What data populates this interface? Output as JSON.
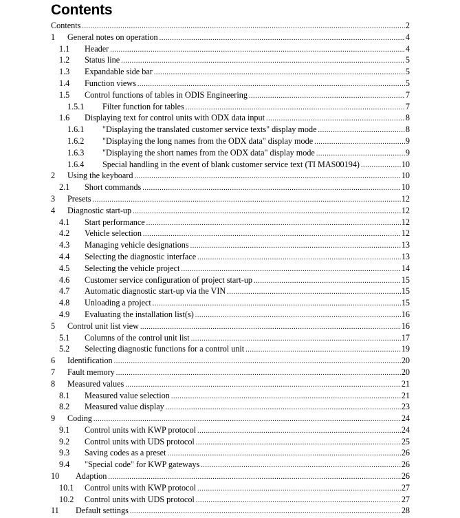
{
  "document": {
    "title": "Contents"
  },
  "toc": [
    {
      "level": 0,
      "number": "",
      "text": "Contents",
      "page": "2"
    },
    {
      "level": 1,
      "number": "1",
      "text": "General notes on operation",
      "page": "4"
    },
    {
      "level": 2,
      "number": "1.1",
      "text": "Header",
      "page": "4"
    },
    {
      "level": 2,
      "number": "1.2",
      "text": "Status line",
      "page": "5"
    },
    {
      "level": 2,
      "number": "1.3",
      "text": "Expandable side bar",
      "page": "5"
    },
    {
      "level": 2,
      "number": "1.4",
      "text": "Function views",
      "page": "5"
    },
    {
      "level": 2,
      "number": "1.5",
      "text": "Control functions of tables in ODIS Engineering",
      "page": "7"
    },
    {
      "level": 3,
      "number": "1.5.1",
      "text": "Filter function for tables",
      "page": "7"
    },
    {
      "level": 2,
      "number": "1.6",
      "text": "Displaying text for control units with ODX data input",
      "page": "8"
    },
    {
      "level": 3,
      "number": "1.6.1",
      "text": "\"Displaying the translated customer service texts\" display mode",
      "page": "8"
    },
    {
      "level": 3,
      "number": "1.6.2",
      "text": "\"Displaying the long names from the ODX data\" display mode",
      "page": "9"
    },
    {
      "level": 3,
      "number": "1.6.3",
      "text": "\"Displaying the short names from the ODX data\" display mode",
      "page": "9"
    },
    {
      "level": 3,
      "number": "1.6.4",
      "text": "Special handling in the event of blank customer service text (TI MAS00194)",
      "page": "10"
    },
    {
      "level": 1,
      "number": "2",
      "text": "Using the keyboard",
      "page": "10"
    },
    {
      "level": 2,
      "number": "2.1",
      "text": "Short commands",
      "page": "10"
    },
    {
      "level": 1,
      "number": "3",
      "text": "Presets",
      "page": "12"
    },
    {
      "level": 1,
      "number": "4",
      "text": "Diagnostic start-up",
      "page": "12"
    },
    {
      "level": 2,
      "number": "4.1",
      "text": "Start performance",
      "page": "12"
    },
    {
      "level": 2,
      "number": "4.2",
      "text": "Vehicle selection",
      "page": "12"
    },
    {
      "level": 2,
      "number": "4.3",
      "text": "Managing vehicle designations",
      "page": "13"
    },
    {
      "level": 2,
      "number": "4.4",
      "text": "Selecting the diagnostic interface",
      "page": "13"
    },
    {
      "level": 2,
      "number": "4.5",
      "text": "Selecting the vehicle project",
      "page": "14"
    },
    {
      "level": 2,
      "number": "4.6",
      "text": "Customer service configuration of project start-up",
      "page": "15"
    },
    {
      "level": 2,
      "number": "4.7",
      "text": "Automatic diagnostic start-up via the VIN",
      "page": "15"
    },
    {
      "level": 2,
      "number": "4.8",
      "text": "Unloading a project",
      "page": "15"
    },
    {
      "level": 2,
      "number": "4.9",
      "text": "Evaluating the installation list(s)",
      "page": "16"
    },
    {
      "level": 1,
      "number": "5",
      "text": "Control unit list view",
      "page": "16"
    },
    {
      "level": 2,
      "number": "5.1",
      "text": "Columns of the control unit list",
      "page": "17"
    },
    {
      "level": 2,
      "number": "5.2",
      "text": "Selecting diagnostic functions for a control unit",
      "page": "19"
    },
    {
      "level": 1,
      "number": "6",
      "text": "Identification",
      "page": "20"
    },
    {
      "level": 1,
      "number": "7",
      "text": "Fault memory",
      "page": "20"
    },
    {
      "level": 1,
      "number": "8",
      "text": "Measured values",
      "page": "21"
    },
    {
      "level": 2,
      "number": "8.1",
      "text": "Measured value selection",
      "page": "21"
    },
    {
      "level": 2,
      "number": "8.2",
      "text": "Measured value display",
      "page": "23"
    },
    {
      "level": 1,
      "number": "9",
      "text": "Coding",
      "page": "24"
    },
    {
      "level": 2,
      "number": "9.1",
      "text": "Control units with KWP protocol",
      "page": "24"
    },
    {
      "level": 2,
      "number": "9.2",
      "text": "Control units with UDS protocol",
      "page": "25"
    },
    {
      "level": 2,
      "number": "9.3",
      "text": "Saving codes as a preset",
      "page": "26"
    },
    {
      "level": 2,
      "number": "9.4",
      "text": "\"Special code\" for KWP gateways",
      "page": "26"
    },
    {
      "level": 1,
      "number": "10",
      "text": "Adaption",
      "page": "26",
      "wide": true
    },
    {
      "level": 2,
      "number": "10.1",
      "text": "Control units with KWP protocol",
      "page": "27"
    },
    {
      "level": 2,
      "number": "10.2",
      "text": "Control units with UDS protocol",
      "page": "27"
    },
    {
      "level": 1,
      "number": "11",
      "text": "Default settings",
      "page": "28",
      "wide": true
    }
  ]
}
